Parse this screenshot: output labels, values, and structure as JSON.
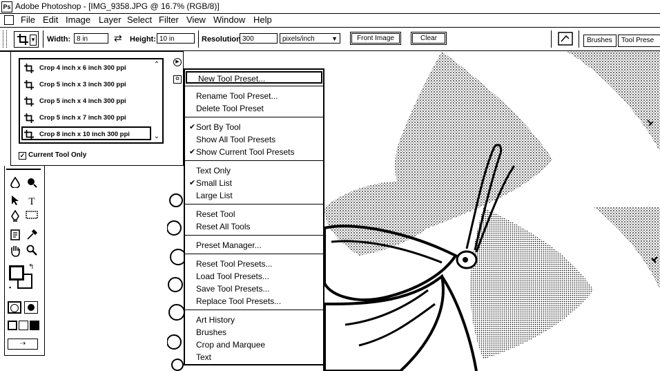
{
  "window": {
    "title": "Adobe Photoshop - [IMG_9358.JPG @ 16.7% (RGB/8)]",
    "app_logo": "Ps"
  },
  "menubar": {
    "items": [
      "File",
      "Edit",
      "Image",
      "Layer",
      "Select",
      "Filter",
      "View",
      "Window",
      "Help"
    ]
  },
  "options": {
    "width_label": "Width:",
    "width_value": "8 in",
    "swap_icon": "⇄",
    "height_label": "Height:",
    "height_value": "10 in",
    "resolution_label": "Resolution:",
    "resolution_value": "300",
    "resolution_unit": "pixels/inch",
    "front_image_label": "Front Image",
    "clear_label": "Clear",
    "brushes_tab": "Brushes",
    "tool_presets_tab": "Tool Prese"
  },
  "preset_picker": {
    "items": [
      "Crop 4 inch x 6 inch 300 ppi",
      "Crop 5 inch x 3 inch 300 ppi",
      "Crop 5 inch x 4 inch 300 ppi",
      "Crop 5 inch x 7 inch 300 ppi",
      "Crop 8 inch x 10 inch 300 ppi"
    ],
    "selected_index": 4,
    "current_tool_only_label": "Current Tool Only",
    "current_tool_only_checked": true
  },
  "menu": {
    "groups": [
      [
        {
          "label": "New Tool Preset...",
          "checked": false,
          "highlighted": true
        }
      ],
      [
        {
          "label": "Rename Tool Preset...",
          "checked": false
        },
        {
          "label": "Delete Tool Preset",
          "checked": false
        }
      ],
      [
        {
          "label": "Sort By Tool",
          "checked": true
        },
        {
          "label": "Show All Tool Presets",
          "checked": false
        },
        {
          "label": "Show Current Tool Presets",
          "checked": true
        }
      ],
      [
        {
          "label": "Text Only",
          "checked": false
        },
        {
          "label": "Small List",
          "checked": true
        },
        {
          "label": "Large List",
          "checked": false
        }
      ],
      [
        {
          "label": "Reset Tool",
          "checked": false
        },
        {
          "label": "Reset All Tools",
          "checked": false
        }
      ],
      [
        {
          "label": "Preset Manager...",
          "checked": false
        }
      ],
      [
        {
          "label": "Reset Tool Presets...",
          "checked": false
        },
        {
          "label": "Load Tool Presets...",
          "checked": false
        },
        {
          "label": "Save Tool Presets...",
          "checked": false
        },
        {
          "label": "Replace Tool Presets...",
          "checked": false
        }
      ],
      [
        {
          "label": "Art History",
          "checked": false
        },
        {
          "label": "Brushes",
          "checked": false
        },
        {
          "label": "Crop and Marquee",
          "checked": false
        },
        {
          "label": "Text",
          "checked": false
        }
      ]
    ]
  },
  "toolbox": {
    "tools": [
      {
        "name": "blur-icon",
        "glyph": "💧"
      },
      {
        "name": "dodge-icon",
        "glyph": "●"
      },
      {
        "name": "path-select-icon",
        "glyph": "↖"
      },
      {
        "name": "type-icon",
        "glyph": "T"
      },
      {
        "name": "pen-icon",
        "glyph": "✒"
      },
      {
        "name": "shape-icon",
        "glyph": "▭"
      },
      {
        "name": "notes-icon",
        "glyph": "🗒"
      },
      {
        "name": "eyedropper-icon",
        "glyph": "⟋"
      },
      {
        "name": "hand-icon",
        "glyph": "✋"
      },
      {
        "name": "zoom-icon",
        "glyph": "🔍"
      }
    ]
  }
}
